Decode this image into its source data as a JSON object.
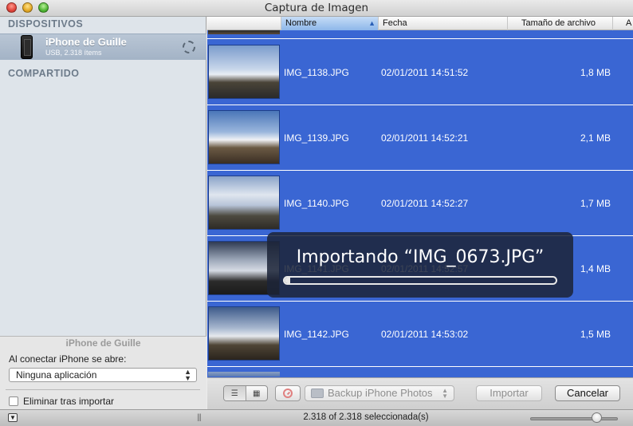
{
  "window": {
    "title": "Captura de Imagen"
  },
  "sidebar": {
    "devices_header": "DISPOSITIVOS",
    "device": {
      "name": "iPhone de Guille",
      "subtitle": "USB, 2.318 ítems"
    },
    "shared_header": "COMPARTIDO",
    "lower": {
      "device_name": "iPhone de Guille",
      "open_label": "Al conectar iPhone se abre:",
      "open_value": "Ninguna aplicación",
      "delete_label": "Eliminar tras importar",
      "delete_checked": false
    }
  },
  "table": {
    "columns": [
      "Nombre",
      "Fecha",
      "Tamaño de archivo",
      "A"
    ],
    "sorted_column": "Nombre",
    "rows": [
      {
        "name": "IMG_1138.JPG",
        "date": "02/01/2011 14:51:52",
        "size": "1,8 MB"
      },
      {
        "name": "IMG_1139.JPG",
        "date": "02/01/2011 14:52:21",
        "size": "2,1 MB"
      },
      {
        "name": "IMG_1140.JPG",
        "date": "02/01/2011 14:52:27",
        "size": "1,7 MB"
      },
      {
        "name": "IMG_1141.JPG",
        "date": "02/01/2011 14:52:57",
        "size": "1,4 MB"
      },
      {
        "name": "IMG_1142.JPG",
        "date": "02/01/2011 14:53:02",
        "size": "1,5 MB"
      }
    ]
  },
  "toolbar": {
    "destination": "Backup iPhone Photos",
    "import_label": "Importar",
    "cancel_label": "Cancelar"
  },
  "status": {
    "text": "2.318 of 2.318 seleccionada(s)",
    "zoom_level": 0.75
  },
  "progress": {
    "title": "Importando “IMG_0673.JPG”",
    "value": 0.02
  },
  "colors": {
    "selection": "#3a66d3",
    "hud": "#1c2438"
  }
}
